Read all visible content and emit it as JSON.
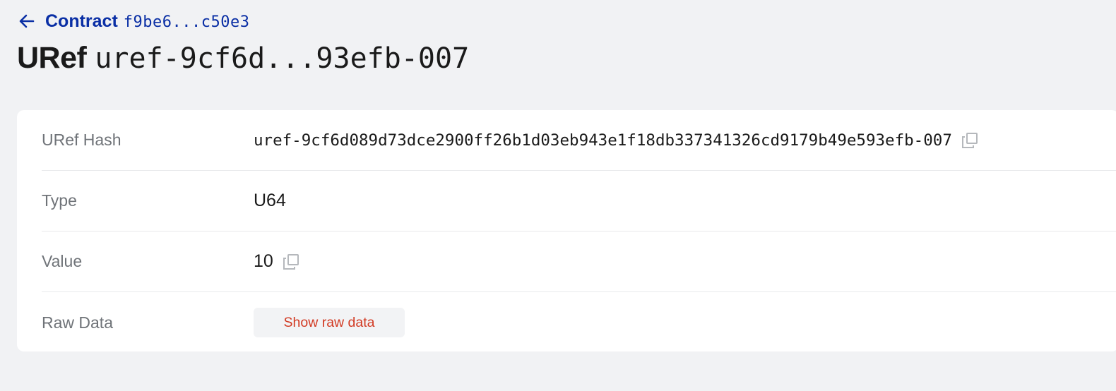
{
  "header": {
    "back_label": "Contract",
    "back_hash": "f9be6...c50e3",
    "title_label": "URef",
    "title_hash": "uref-9cf6d...93efb-007"
  },
  "details": {
    "rows": [
      {
        "label": "URef Hash",
        "value": "uref-9cf6d089d73dce2900ff26b1d03eb943e1f18db337341326cd9179b49e593efb-007",
        "copyable": true
      },
      {
        "label": "Type",
        "value": "U64",
        "copyable": false
      },
      {
        "label": "Value",
        "value": "10",
        "copyable": true
      },
      {
        "label": "Raw Data",
        "button_label": "Show raw data"
      }
    ]
  },
  "colors": {
    "link": "#0a2fa5",
    "accent_button_text": "#d23a23",
    "page_background": "#f1f2f4",
    "card_background": "#ffffff"
  },
  "icons": {
    "back": "arrow-left-icon",
    "copy": "copy-icon"
  }
}
